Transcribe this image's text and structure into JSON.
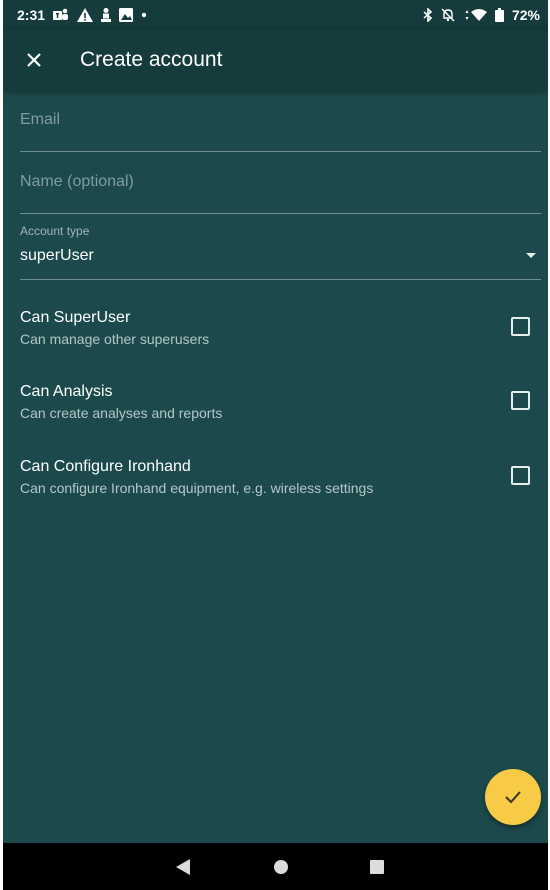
{
  "status_bar": {
    "time": "2:31",
    "battery": "72%",
    "left_icons": [
      "teams-icon",
      "warning-icon",
      "person-icon",
      "image-icon",
      "dot-icon"
    ],
    "right_icons": [
      "bluetooth-icon",
      "bell-off-icon",
      "wifi-icon",
      "battery-icon"
    ]
  },
  "app_bar": {
    "title": "Create account",
    "close_icon": "close-icon"
  },
  "form": {
    "email": {
      "placeholder": "Email",
      "value": ""
    },
    "name": {
      "placeholder": "Name (optional)",
      "value": ""
    },
    "account_type": {
      "label": "Account type",
      "value": "superUser"
    }
  },
  "permissions": [
    {
      "title": "Can SuperUser",
      "description": "Can manage other superusers",
      "checked": false
    },
    {
      "title": "Can Analysis",
      "description": "Can create analyses and reports",
      "checked": false
    },
    {
      "title": "Can Configure Ironhand",
      "description": "Can configure Ironhand equipment, e.g. wireless settings",
      "checked": false
    }
  ],
  "fab": {
    "icon": "check-icon"
  },
  "nav_bar": {
    "icons": [
      "back-icon",
      "home-icon",
      "recents-icon"
    ]
  },
  "colors": {
    "background": "#1c4a4c",
    "app_bar": "#163b3d",
    "accent": "#f7cb45",
    "text_primary": "#ffffff",
    "text_secondary": "#b4c6c7"
  }
}
